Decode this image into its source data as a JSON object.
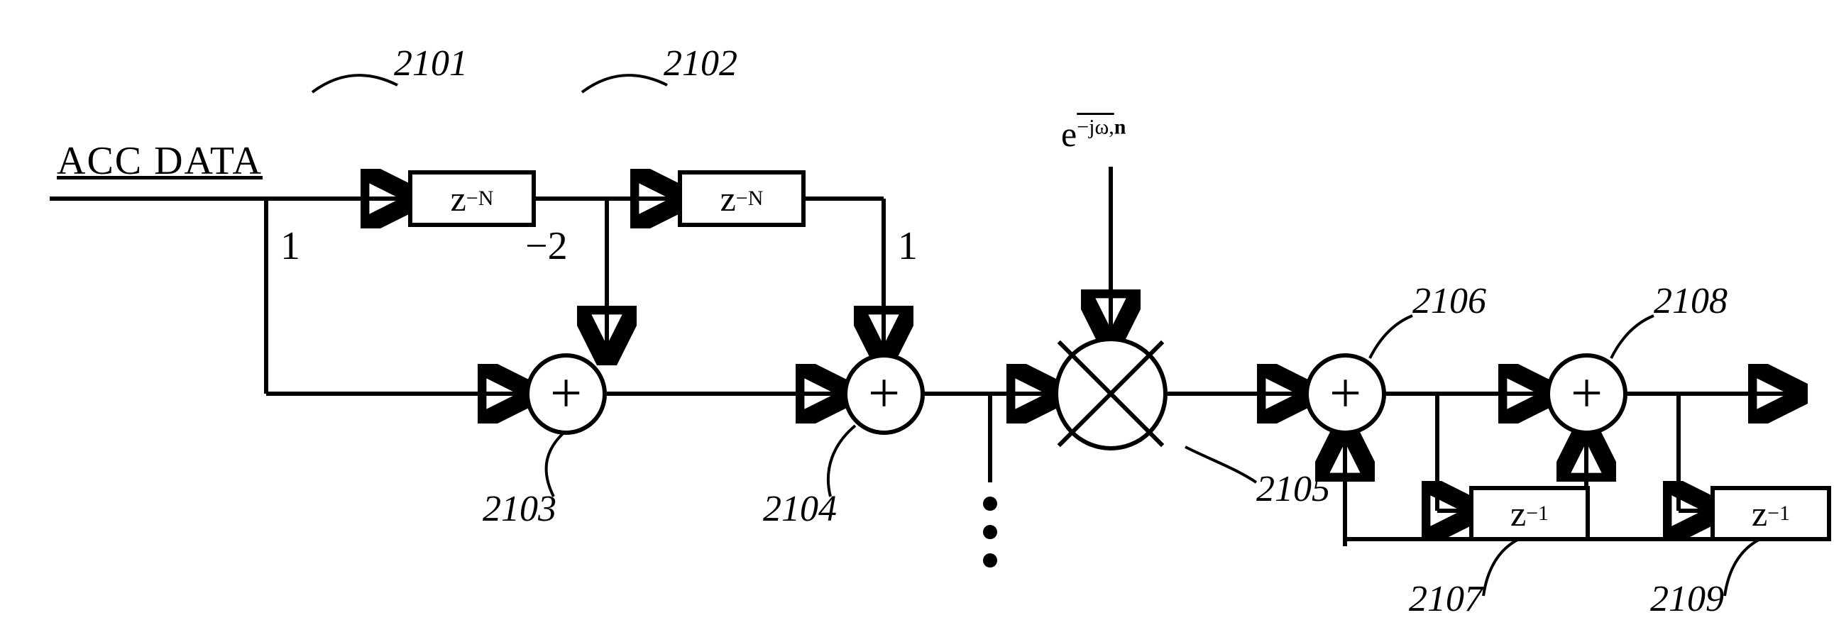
{
  "input_label": "ACC DATA",
  "exp_input": "e",
  "exp_sup_prefix": "−jω,",
  "exp_sup_bold": "n",
  "delay_2101": {
    "base": "z",
    "sup": "−N"
  },
  "delay_2102": {
    "base": "z",
    "sup": "−N"
  },
  "delay_2107": {
    "base": "z",
    "sup": "−1"
  },
  "delay_2109": {
    "base": "z",
    "sup": "−1"
  },
  "coeff_tap1": "1",
  "coeff_tap2": "−2",
  "coeff_tap3": "1",
  "adder_plus": "+",
  "refs": {
    "r2101": "2101",
    "r2102": "2102",
    "r2103": "2103",
    "r2104": "2104",
    "r2105": "2105",
    "r2106": "2106",
    "r2107": "2107",
    "r2108": "2108",
    "r2109": "2109"
  }
}
